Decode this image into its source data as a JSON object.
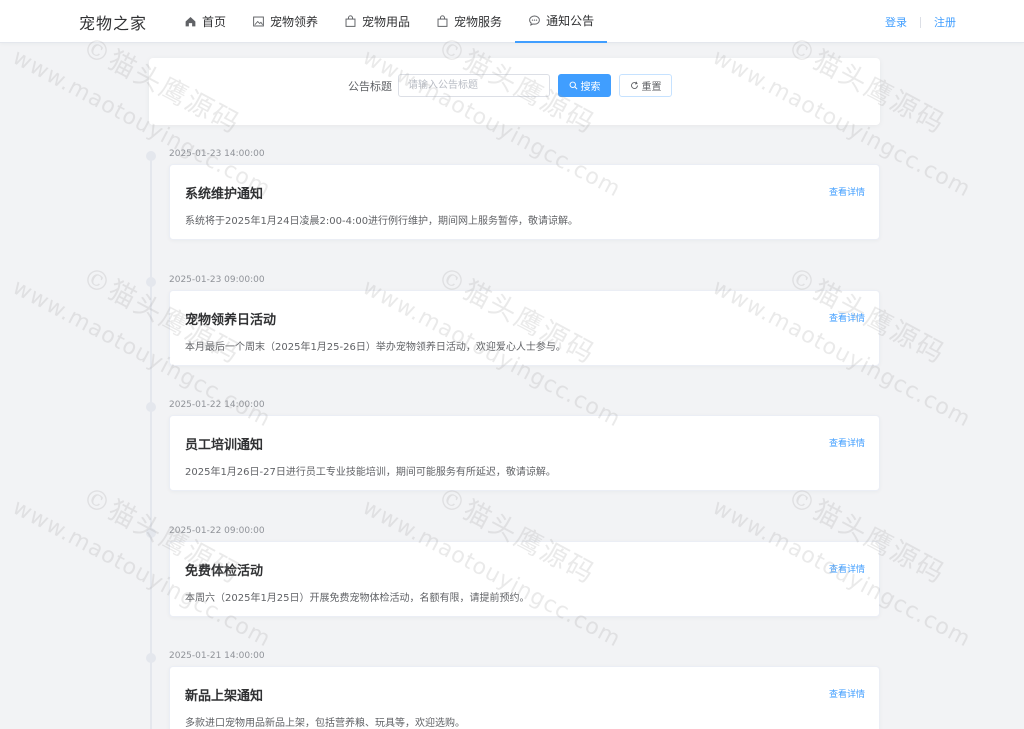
{
  "header": {
    "logo": "宠物之家",
    "nav": [
      {
        "label": "首页",
        "icon": "home-icon"
      },
      {
        "label": "宠物领养",
        "icon": "picture-icon"
      },
      {
        "label": "宠物用品",
        "icon": "shopping-bag-icon"
      },
      {
        "label": "宠物服务",
        "icon": "shopping-bag-icon"
      },
      {
        "label": "通知公告",
        "icon": "chat-bubble-icon",
        "active": true
      }
    ],
    "login": "登录",
    "register": "注册"
  },
  "search": {
    "label": "公告标题",
    "placeholder": "请输入公告标题",
    "value": "",
    "search_button": "搜索",
    "reset_button": "重置"
  },
  "notices": [
    {
      "time": "2025-01-23 14:00:00",
      "title": "系统维护通知",
      "content": "系统将于2025年1月24日凌晨2:00-4:00进行例行维护，期间网上服务暂停，敬请谅解。",
      "link": "查看详情"
    },
    {
      "time": "2025-01-23 09:00:00",
      "title": "宠物领养日活动",
      "content": "本月最后一个周末（2025年1月25-26日）举办宠物领养日活动，欢迎爱心人士参与。",
      "link": "查看详情"
    },
    {
      "time": "2025-01-22 14:00:00",
      "title": "员工培训通知",
      "content": "2025年1月26日-27日进行员工专业技能培训，期间可能服务有所延迟，敬请谅解。",
      "link": "查看详情"
    },
    {
      "time": "2025-01-22 09:00:00",
      "title": "免费体检活动",
      "content": "本周六（2025年1月25日）开展免费宠物体检活动，名额有限，请提前预约。",
      "link": "查看详情"
    },
    {
      "time": "2025-01-21 14:00:00",
      "title": "新品上架通知",
      "content": "多款进口宠物用品新品上架，包括营养粮、玩具等，欢迎选购。",
      "link": "查看详情"
    }
  ],
  "watermark": {
    "line1": "©猫头鹰源码",
    "line2": "www.maotouyingcc.com"
  },
  "colors": {
    "accent": "#409eff",
    "background": "#f2f3f5",
    "card": "#ffffff"
  }
}
